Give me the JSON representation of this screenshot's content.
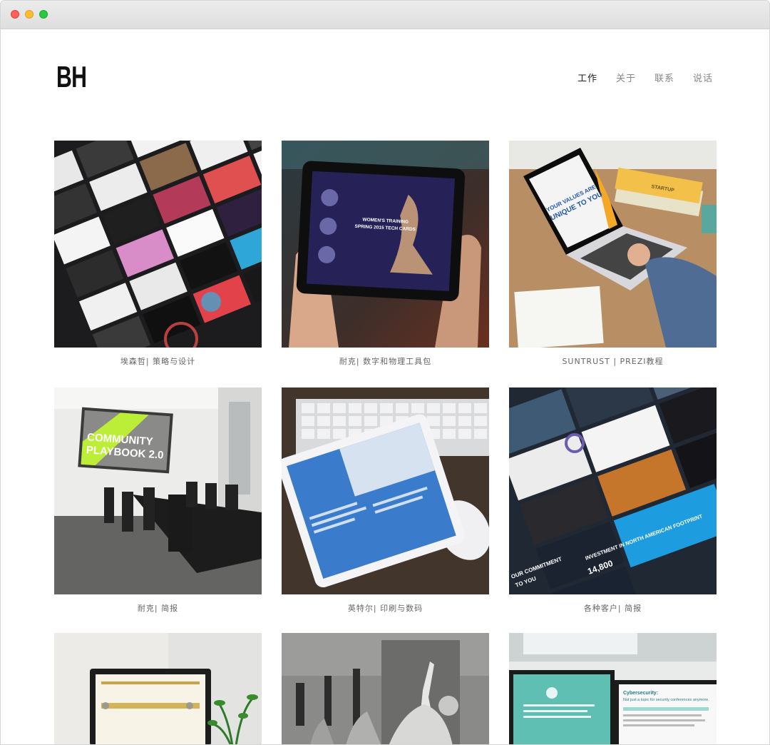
{
  "brand": {
    "logo": "BH"
  },
  "nav": [
    {
      "label": "工作",
      "active": true
    },
    {
      "label": "关于",
      "active": false
    },
    {
      "label": "联系",
      "active": false
    },
    {
      "label": "说话",
      "active": false
    }
  ],
  "portfolio": [
    {
      "caption": "埃森哲| 策略与设计"
    },
    {
      "caption": "耐克| 数字和物理工具包"
    },
    {
      "caption": "SUNTRUST | PREZI教程"
    },
    {
      "caption": "耐克| 简报"
    },
    {
      "caption": "英特尔| 印刷与数码"
    },
    {
      "caption": "各种客户| 简报"
    },
    {
      "caption": ""
    },
    {
      "caption": ""
    },
    {
      "caption": ""
    }
  ],
  "artwork_text": {
    "nike_tablet": "WOMEN'S TRAINING\nSPRING 2015 TECH CARDS",
    "laptop_screen": "YOUR VALUES ARE\nUNIQUE TO YOU",
    "book_label": "STARTUP",
    "poster": "COMMUNITY\nPLAYBOOK 2.0",
    "slide_big": "INVESTMENT IN NORTH AMERICAN FOOTPRINT",
    "slide_small": "14,800",
    "slide_commit": "OUR COMMITMENT\nTO YOU",
    "monitor_right": "Cybersecurity:\nNot just a topic for security conferences anymore."
  },
  "colors": {
    "accent_blue": "#2f6fb6",
    "nike_purple": "#2b2663",
    "accent_yellow": "#f0b429",
    "accent_green": "#b6e63a"
  }
}
